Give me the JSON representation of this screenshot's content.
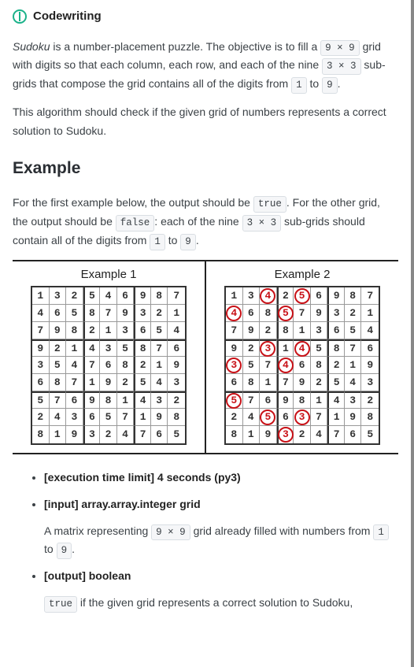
{
  "header": {
    "title": "Codewriting"
  },
  "intro": {
    "sudoku_word": "Sudoku",
    "p1a": " is a number-placement puzzle. The objective is to fill a ",
    "dim": "9 × 9",
    "p1b": " grid with digits so that each column, each row, and each of the nine ",
    "subdim": "3 × 3",
    "p1c": " sub-grids that compose the grid contains all of the digits from ",
    "one": "1",
    "p1d": " to ",
    "nine": "9",
    "p1e": ".",
    "p2": "This algorithm should check if the given grid of numbers represents a correct solution to Sudoku."
  },
  "example_heading": "Example",
  "example_text": {
    "a": "For the first example below, the output should be ",
    "true": "true",
    "b": ". For the other grid, the output should be ",
    "false": "false",
    "c": ": each of the nine ",
    "subdim": "3 × 3",
    "d": " sub-grids should contain all of the digits from ",
    "one": "1",
    "e": " to ",
    "nine": "9",
    "f": "."
  },
  "ex1_label": "Example 1",
  "ex2_label": "Example 2",
  "grid1": [
    [
      1,
      3,
      2,
      5,
      4,
      6,
      9,
      8,
      7
    ],
    [
      4,
      6,
      5,
      8,
      7,
      9,
      3,
      2,
      1
    ],
    [
      7,
      9,
      8,
      2,
      1,
      3,
      6,
      5,
      4
    ],
    [
      9,
      2,
      1,
      4,
      3,
      5,
      8,
      7,
      6
    ],
    [
      3,
      5,
      4,
      7,
      6,
      8,
      2,
      1,
      9
    ],
    [
      6,
      8,
      7,
      1,
      9,
      2,
      5,
      4,
      3
    ],
    [
      5,
      7,
      6,
      9,
      8,
      1,
      4,
      3,
      2
    ],
    [
      2,
      4,
      3,
      6,
      5,
      7,
      1,
      9,
      8
    ],
    [
      8,
      1,
      9,
      3,
      2,
      4,
      7,
      6,
      5
    ]
  ],
  "grid2": [
    [
      1,
      3,
      4,
      2,
      5,
      6,
      9,
      8,
      7
    ],
    [
      4,
      6,
      8,
      5,
      7,
      9,
      3,
      2,
      1
    ],
    [
      7,
      9,
      2,
      8,
      1,
      3,
      6,
      5,
      4
    ],
    [
      9,
      2,
      3,
      1,
      4,
      5,
      8,
      7,
      6
    ],
    [
      3,
      5,
      7,
      4,
      6,
      8,
      2,
      1,
      9
    ],
    [
      6,
      8,
      1,
      7,
      9,
      2,
      5,
      4,
      3
    ],
    [
      5,
      7,
      6,
      9,
      8,
      1,
      4,
      3,
      2
    ],
    [
      2,
      4,
      5,
      6,
      3,
      7,
      1,
      9,
      8
    ],
    [
      8,
      1,
      9,
      3,
      2,
      4,
      7,
      6,
      5
    ]
  ],
  "marks2": [
    [
      0,
      2
    ],
    [
      0,
      4
    ],
    [
      1,
      0
    ],
    [
      1,
      3
    ],
    [
      3,
      2
    ],
    [
      3,
      4
    ],
    [
      4,
      0
    ],
    [
      4,
      3
    ],
    [
      6,
      0
    ],
    [
      7,
      2
    ],
    [
      7,
      4
    ],
    [
      8,
      3
    ]
  ],
  "spec": {
    "time_label": "[execution time limit] 4 seconds (py3)",
    "input_label": "[input] array.array.integer grid",
    "input_desc_a": "A matrix representing ",
    "input_dim": "9 × 9",
    "input_desc_b": " grid already filled with numbers from ",
    "one": "1",
    "input_desc_c": " to ",
    "nine": "9",
    "input_desc_d": ".",
    "output_label": "[output] boolean",
    "output_true": "true",
    "output_desc": " if the given grid represents a correct solution to Sudoku,"
  }
}
